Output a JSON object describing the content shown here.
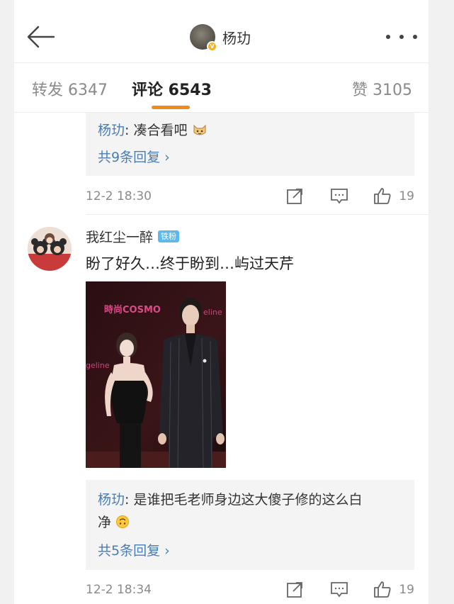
{
  "header": {
    "title": "杨玏",
    "back_icon": "arrow-left-icon",
    "more_icon": "more-dots-icon"
  },
  "tabs": [
    {
      "label": "转发 6347"
    },
    {
      "label": "评论 6543",
      "active": true
    },
    {
      "label": "赞 3105"
    }
  ],
  "accent_color": "#f08a1e",
  "link_color": "#4a7db5",
  "comment1": {
    "reply": {
      "author": "杨玏",
      "text": ": 凑合看吧"
    },
    "more_replies": "共9条回复 ›",
    "time": "12-2 18:30",
    "likes": "19"
  },
  "comment2": {
    "username": "我红尘一醉",
    "badge": "铁粉",
    "text": "盼了好久…终于盼到…屿过天芹",
    "photo_texts": {
      "brand": "時尚COSMO",
      "left_edge": "geline",
      "right_edge": "eline"
    },
    "reply": {
      "author": "杨玏",
      "text_line1": ": 是谁把毛老师身边这大傻子修的这么白",
      "text_line2": "净"
    },
    "more_replies": "共5条回复 ›",
    "time": "12-2 18:34",
    "likes": "19"
  }
}
